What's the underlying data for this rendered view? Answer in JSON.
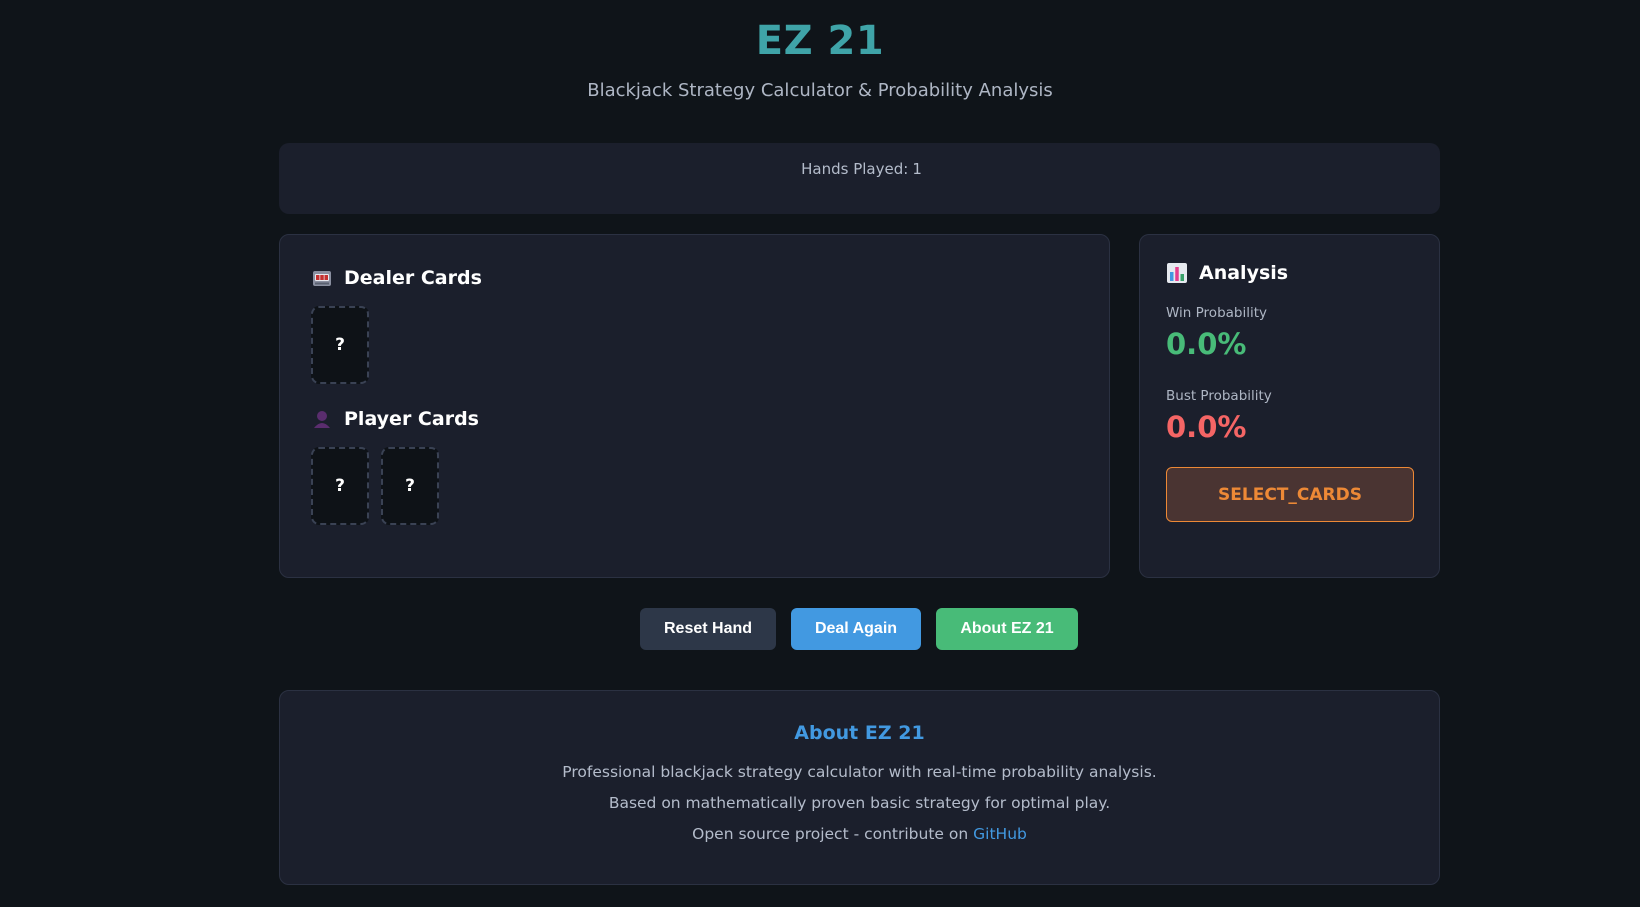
{
  "header": {
    "title": "EZ 21",
    "subtitle": "Blackjack Strategy Calculator & Probability Analysis"
  },
  "stats": {
    "hands_label": "Hands Played:",
    "hands_value": "1"
  },
  "table": {
    "dealer_title": "Dealer Cards",
    "dealer_icon": "slot-machine-icon",
    "dealer_cards": [
      "?"
    ],
    "player_title": "Player Cards",
    "player_icon": "person-icon",
    "player_cards": [
      "?",
      "?"
    ]
  },
  "analysis": {
    "title": "Analysis",
    "icon": "bar-chart-icon",
    "win_label": "Win Probability",
    "win_value": "0.0%",
    "bust_label": "Bust Probability",
    "bust_value": "0.0%",
    "action_label": "SELECT_CARDS"
  },
  "buttons": {
    "reset": "Reset Hand",
    "deal": "Deal Again",
    "about": "About EZ 21"
  },
  "about": {
    "title": "About EZ 21",
    "line1": "Professional blackjack strategy calculator with real-time probability analysis.",
    "line2": "Based on mathematically proven basic strategy for optimal play.",
    "line3_prefix": "Open source project - contribute on",
    "link_text": "GitHub"
  },
  "colors": {
    "background": "#0f1419",
    "panel": "#1b1f2c",
    "title": "#3fa4a8",
    "win": "#48bb78",
    "bust": "#f56565",
    "accent_orange": "#ed8936",
    "accent_blue": "#4299e1"
  }
}
